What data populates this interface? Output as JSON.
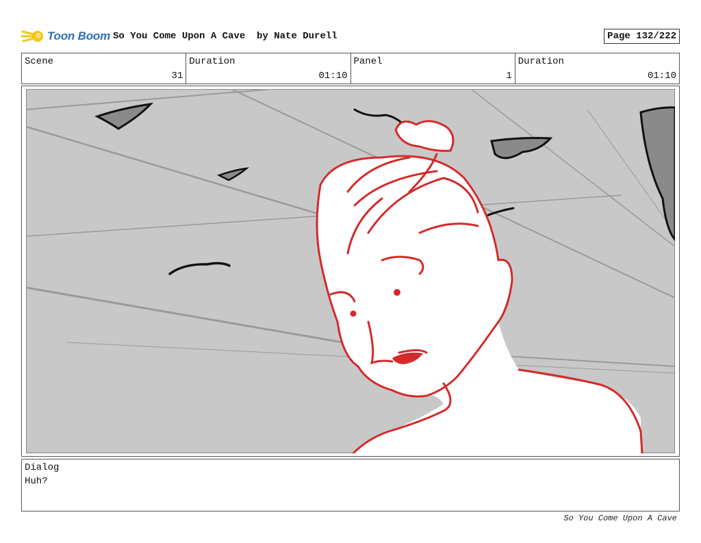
{
  "header": {
    "logo_text": "Toon Boom",
    "title": "So You Come Upon A Cave  by Nate Durell",
    "page_label": "Page 132/222"
  },
  "info": {
    "scene_label": "Scene",
    "scene_value": "31",
    "duration_label": "Duration",
    "duration_value": "01:10",
    "panel_label": "Panel",
    "panel_value": "1",
    "panel_duration_label": "Duration",
    "panel_duration_value": "01:10"
  },
  "dialog": {
    "label": "Dialog",
    "text": "Huh?"
  },
  "footer": {
    "text": "So You Come Upon A Cave"
  },
  "colors": {
    "sketch_red": "#d42a2a",
    "background_gray": "#c8c8c8",
    "rock_gray": "#8a8a8a",
    "logo_blue": "#2f6fb6",
    "logo_yellow": "#f5c518"
  }
}
